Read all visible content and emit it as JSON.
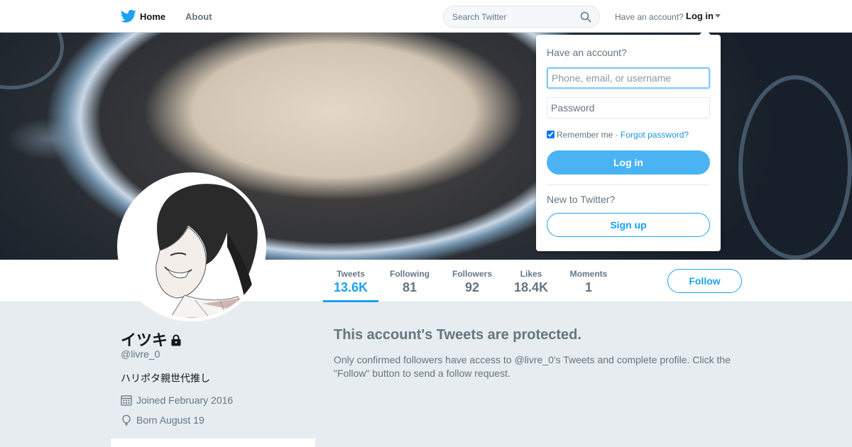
{
  "nav": {
    "home_label": "Home",
    "about_label": "About",
    "search_placeholder": "Search Twitter",
    "have_account": "Have an account?",
    "login_label": "Log in",
    "logo_icon": "twitter-bird-icon",
    "brand_color": "#1da1f2"
  },
  "profile": {
    "name": "イツキ",
    "handle": "@livre_0",
    "bio": "ハリポタ親世代推し",
    "joined": "Joined February 2016",
    "born": "Born August 19",
    "protected_icon": "lock-icon"
  },
  "stats": [
    {
      "label": "Tweets",
      "value": "13.6K",
      "active": true
    },
    {
      "label": "Following",
      "value": "81"
    },
    {
      "label": "Followers",
      "value": "92"
    },
    {
      "label": "Likes",
      "value": "18.4K"
    },
    {
      "label": "Moments",
      "value": "1"
    }
  ],
  "follow_label": "Follow",
  "protected": {
    "title": "This account's Tweets are protected.",
    "text": "Only confirmed followers have access to @livre_0's Tweets and complete profile. Click the \"Follow\" button to send a follow request."
  },
  "login_dropdown": {
    "title": "Have an account?",
    "username_placeholder": "Phone, email, or username",
    "password_placeholder": "Password",
    "remember_label": "Remember me",
    "separator": "·",
    "forgot_label": "Forgot password?",
    "remember_checked": true,
    "login_button": "Log in",
    "new_label": "New to Twitter?",
    "signup_button": "Sign up"
  }
}
